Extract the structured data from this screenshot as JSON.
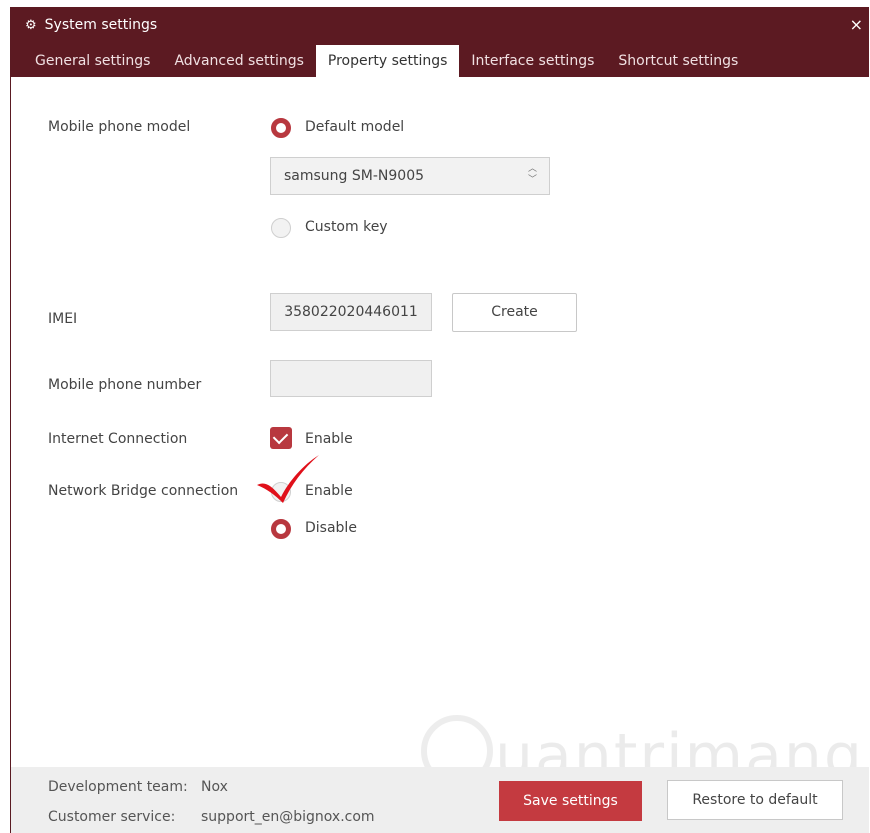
{
  "window": {
    "title": "System settings",
    "title_icon": "gear-icon",
    "close_icon": "close-icon",
    "close_label": "×"
  },
  "tabs": [
    {
      "label": "General settings",
      "active": false
    },
    {
      "label": "Advanced settings",
      "active": false
    },
    {
      "label": "Property settings",
      "active": true
    },
    {
      "label": "Interface settings",
      "active": false
    },
    {
      "label": "Shortcut settings",
      "active": false
    }
  ],
  "form": {
    "model_label": "Mobile phone model",
    "model_option_default": "Default model",
    "model_option_custom": "Custom key",
    "model_selected": "samsung SM-N9005",
    "imei_label": "IMEI",
    "imei_value": "358022020446011",
    "create_button": "Create",
    "phone_number_label": "Mobile phone number",
    "phone_number_value": "",
    "internet_label": "Internet Connection",
    "internet_enable": "Enable",
    "bridge_label": "Network Bridge connection",
    "bridge_enable": "Enable",
    "bridge_disable": "Disable"
  },
  "footer": {
    "dev_team_label": "Development team:",
    "dev_team_value": "Nox",
    "service_label": "Customer service:",
    "service_value": "support_en@bignox.com",
    "save_button": "Save settings",
    "restore_button": "Restore to default"
  },
  "watermark": "uantrimang",
  "colors": {
    "titlebar": "#5c1a22",
    "accent": "#b8383f",
    "annotation": "#e0101a"
  }
}
